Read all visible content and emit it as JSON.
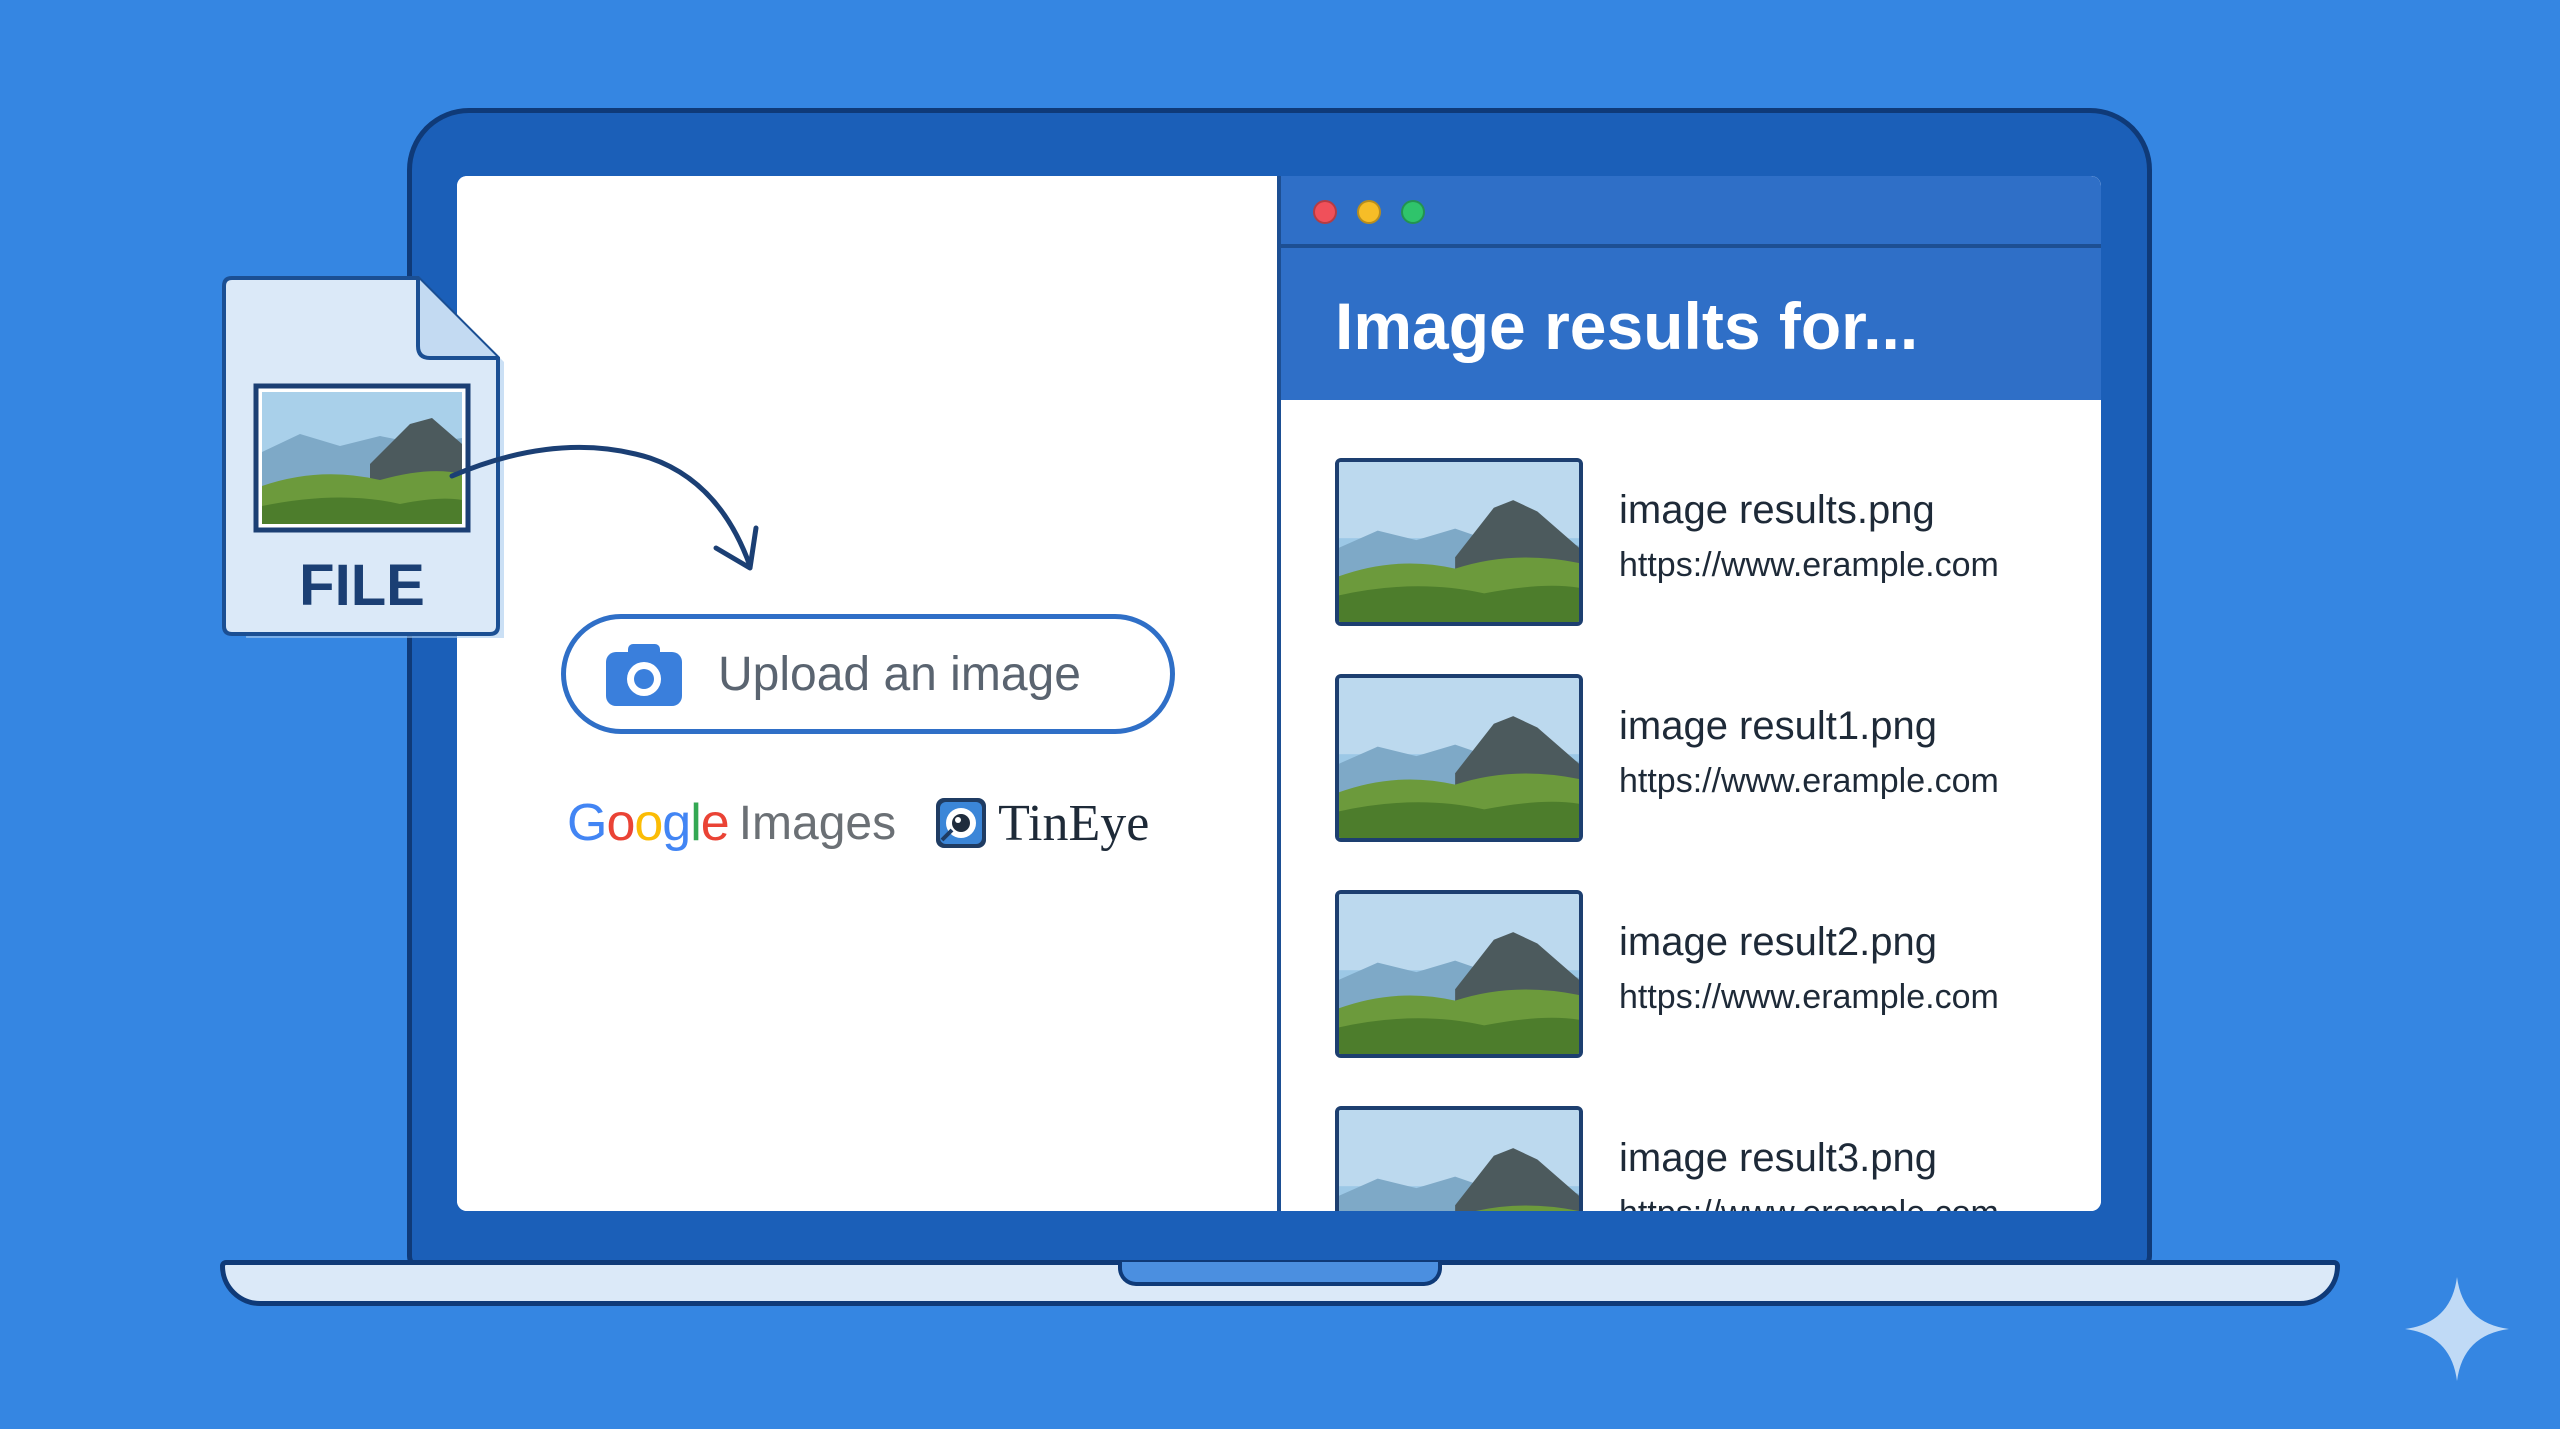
{
  "left_pane": {
    "upload": {
      "label": "Upload an image",
      "icon": "camera-icon"
    },
    "engines": {
      "google": [
        "G",
        "o",
        "o",
        "g",
        "l",
        "e"
      ],
      "google_suffix": "Images",
      "tineye": "TinEye"
    }
  },
  "file": {
    "label": "FILE",
    "icon": "image-file-icon"
  },
  "browser": {
    "window_controls": [
      "close",
      "minimize",
      "maximize"
    ],
    "title": "Image results for...",
    "results": [
      {
        "name": "image results.png",
        "url": "https://www.erample.com"
      },
      {
        "name": "image result1.png",
        "url": "https://www.erample.com"
      },
      {
        "name": "image result2.png",
        "url": "https://www.erample.com"
      },
      {
        "name": "image result3.png",
        "url": "https://www.erample.com"
      }
    ]
  },
  "colors": {
    "background": "#3586e2",
    "accent": "#2f6fc7",
    "frame": "#0f3a78"
  }
}
